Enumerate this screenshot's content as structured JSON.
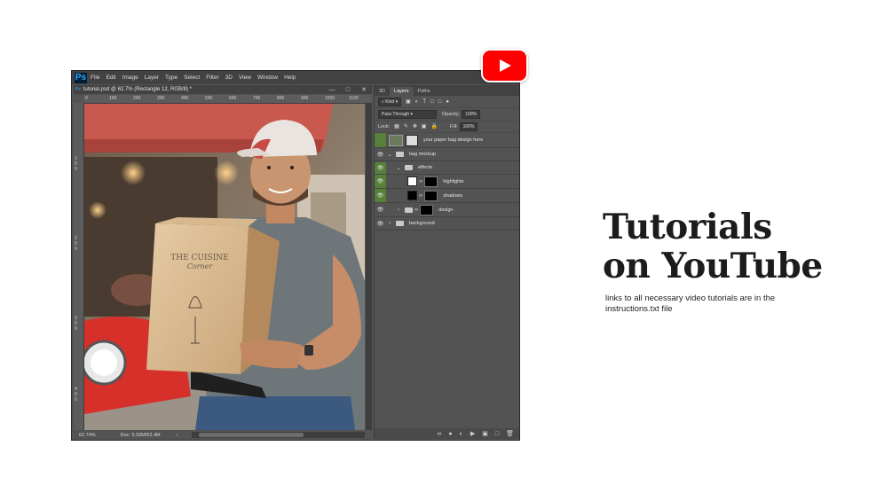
{
  "ps": {
    "logo": "Ps",
    "menu": [
      "File",
      "Edit",
      "Image",
      "Layer",
      "Type",
      "Select",
      "Filter",
      "3D",
      "View",
      "Window",
      "Help"
    ],
    "doc_title": "tutorial.psd @ 62.7% (Rectangle 12, RGB/8) *",
    "window_controls": [
      "—",
      "□",
      "✕"
    ],
    "ruler_h": [
      "0",
      "100",
      "200",
      "300",
      "400",
      "500",
      "600",
      "700",
      "800",
      "900",
      "1000",
      "1100"
    ],
    "ruler_v": [
      "1",
      "0",
      "0",
      "2",
      "0",
      "0",
      "3",
      "0",
      "0",
      "4",
      "0",
      "0"
    ],
    "status_zoom": "62.74%",
    "status_doc": "Doc: 5.93M/62.4M",
    "status_arrow": "›"
  },
  "panel": {
    "tabs": [
      "3D",
      "Layers",
      "Paths"
    ],
    "kind_label": "Kind",
    "blend_mode": "Pass Through",
    "opacity_label": "Opacity:",
    "opacity_value": "100%",
    "lock_label": "Lock:",
    "fill_label": "Fill:",
    "fill_value": "100%",
    "layers": [
      {
        "name": "your paper bag design here"
      },
      {
        "name": "bag mockup"
      },
      {
        "name": "effects"
      },
      {
        "name": "highlights"
      },
      {
        "name": "shadows"
      },
      {
        "name": "design"
      },
      {
        "name": "background"
      }
    ]
  },
  "artwork": {
    "bag_brand_line1": "THE CUISINE",
    "bag_brand_line2": "Corner"
  },
  "promo": {
    "title_line1": "Tutorials",
    "title_line2": "on YouTube",
    "subtitle": "links to all necessary video tutorials are in the instructions.txt file"
  },
  "colors": {
    "ps_bg": "#535353",
    "ps_bar": "#424242",
    "visible_green": "#57803a",
    "youtube_red": "#ff0000",
    "heading": "#1c1c1c"
  },
  "icons": {
    "youtube": "youtube-play-icon",
    "eye": "eye-icon",
    "folder": "folder-icon"
  }
}
